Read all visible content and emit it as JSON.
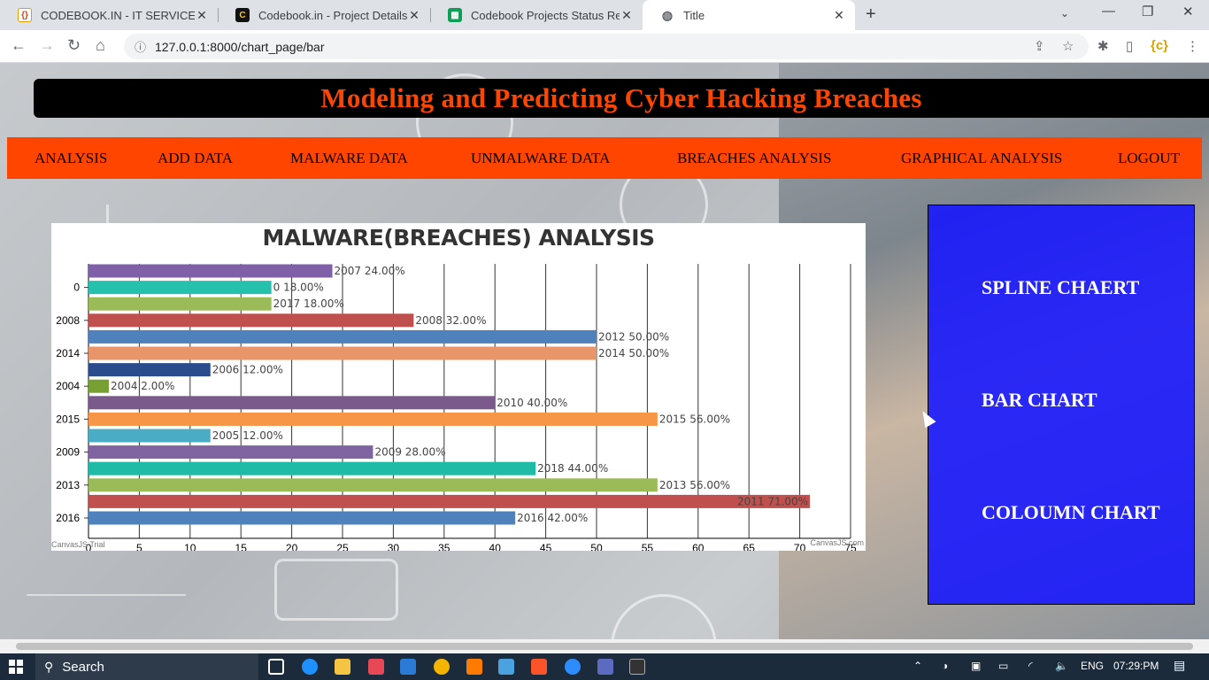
{
  "browser": {
    "tabs": [
      {
        "title": "CODEBOOK.IN - IT SERVICES",
        "icon": "codebook-favicon",
        "active": false
      },
      {
        "title": "Codebook.in - Project Details",
        "icon": "codebook-dark-favicon",
        "active": false
      },
      {
        "title": "Codebook Projects Status Report",
        "icon": "sheets-favicon",
        "active": false
      },
      {
        "title": "Title",
        "icon": "globe-favicon",
        "active": true
      }
    ],
    "url": "127.0.0.1:8000/chart_page/bar"
  },
  "site": {
    "title": "Modeling and Predicting Cyber Hacking Breaches",
    "menu": [
      "ANALYSIS",
      "ADD DATA",
      "MALWARE DATA",
      "UNMALWARE DATA",
      "BREACHES ANALYSIS",
      "GRAPHICAL ANALYSIS",
      "LOGOUT"
    ],
    "side_links": [
      "SPLINE CHAERT",
      "BAR CHART",
      "COLOUMN CHART"
    ],
    "colors": {
      "header_text": "#ff4500",
      "menu_bg": "#ff4500",
      "side_panel_bg": "#1414ff"
    }
  },
  "chart_credits": {
    "left": "CanvasJS Trial",
    "right": "CanvasJS.com"
  },
  "chart_data": {
    "type": "bar",
    "orientation": "horizontal",
    "title": "MALWARE(BREACHES) ANALYSIS",
    "xlim": [
      0,
      75
    ],
    "x_ticks": [
      "0",
      "5",
      "10",
      "15",
      "20",
      "25",
      "30",
      "35",
      "40",
      "45",
      "50",
      "55",
      "60",
      "65",
      "70",
      "75"
    ],
    "category_tick_labels": [
      "0",
      "2008",
      "2014",
      "2004",
      "2015",
      "2009",
      "2013",
      "2016"
    ],
    "bars": [
      {
        "label": "2007 24.00%",
        "value": 24,
        "color": "#7f5fa8"
      },
      {
        "label": "0 18.00%",
        "value": 18,
        "color": "#26c1ad"
      },
      {
        "label": "2017 18.00%",
        "value": 18,
        "color": "#9bbb59"
      },
      {
        "label": "2008 32.00%",
        "value": 32,
        "color": "#c0504d"
      },
      {
        "label": "2012 50.00%",
        "value": 50,
        "color": "#4f81bd"
      },
      {
        "label": "2014 50.00%",
        "value": 50,
        "color": "#e8956a"
      },
      {
        "label": "2006 12.00%",
        "value": 12,
        "color": "#2b4c8c"
      },
      {
        "label": "2004 2.00%",
        "value": 2,
        "color": "#77a033"
      },
      {
        "label": "2010 40.00%",
        "value": 40,
        "color": "#7a5a8a"
      },
      {
        "label": "2015 56.00%",
        "value": 56,
        "color": "#f79646"
      },
      {
        "label": "2005 12.00%",
        "value": 12,
        "color": "#4bacc6"
      },
      {
        "label": "2009 28.00%",
        "value": 28,
        "color": "#8064a2"
      },
      {
        "label": "2018 44.00%",
        "value": 44,
        "color": "#1fbba6"
      },
      {
        "label": "2013 56.00%",
        "value": 56,
        "color": "#9bbb59"
      },
      {
        "label": "2011 71.00%",
        "value": 71,
        "color": "#c0504d"
      },
      {
        "label": "2016 42.00%",
        "value": 42,
        "color": "#4f81bd"
      }
    ]
  },
  "taskbar": {
    "search": "Search",
    "language": "ENG",
    "time": "07:29:PM"
  }
}
